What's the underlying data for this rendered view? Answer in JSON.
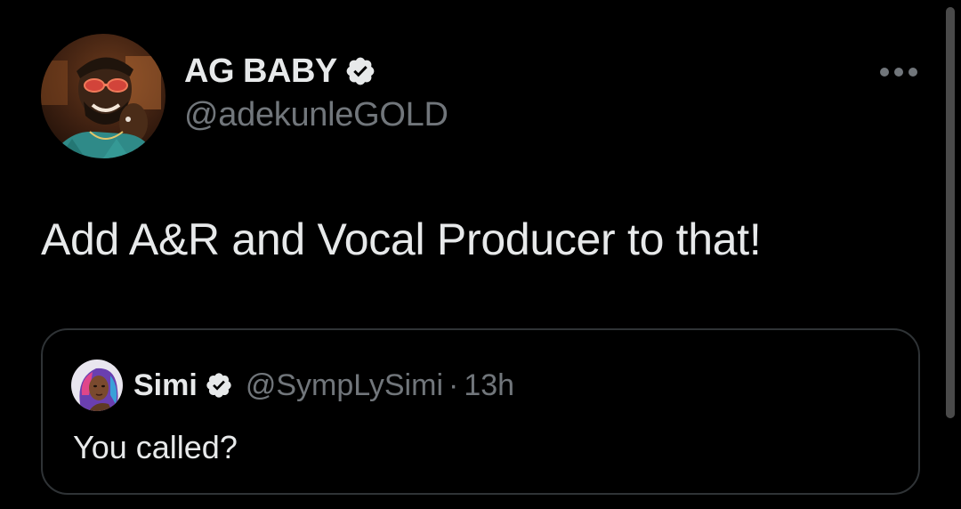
{
  "tweet": {
    "author": {
      "display_name": "AG BABY",
      "handle": "@adekunleGOLD",
      "verified": true,
      "avatar_icon": "profile-photo"
    },
    "text": "Add A&R and Vocal Producer to that!",
    "more_icon": "more-horizontal-icon"
  },
  "quoted_tweet": {
    "author": {
      "display_name": "Simi",
      "handle": "@SympLySimi",
      "verified": true,
      "avatar_icon": "profile-illustration"
    },
    "separator": "·",
    "time": "13h",
    "text": "You called?"
  },
  "colors": {
    "background": "#000000",
    "primary_text": "#e7e9ea",
    "secondary_text": "#71767b",
    "border": "#2f3336",
    "verified_badge": "#e7e9ea"
  }
}
